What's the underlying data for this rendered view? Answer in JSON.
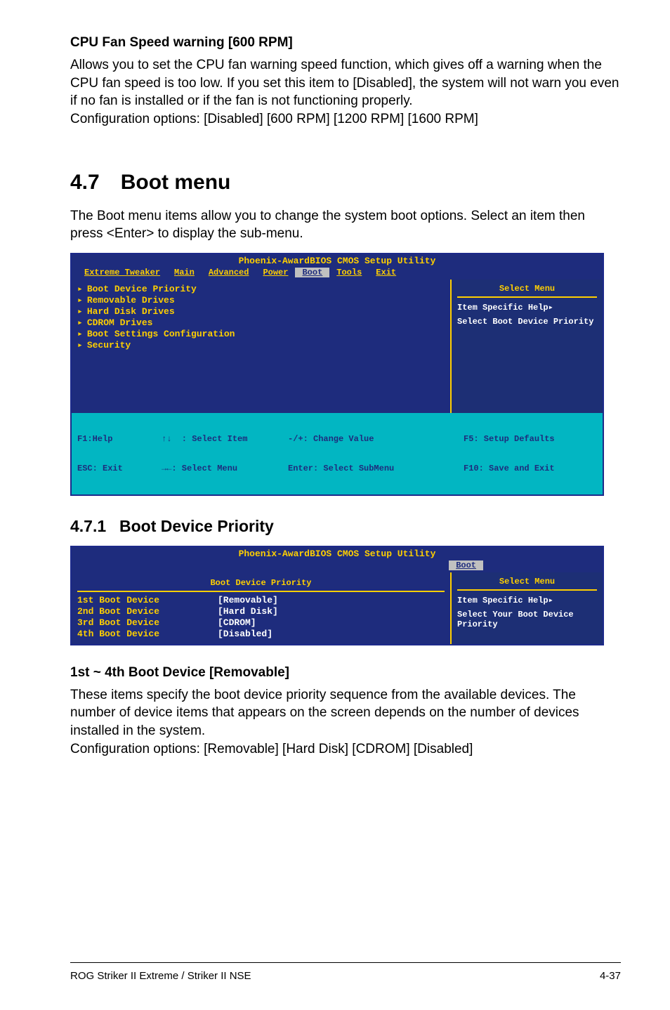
{
  "sec1": {
    "title": "CPU Fan Speed warning [600 RPM]",
    "body": "Allows you to set the CPU fan warning speed function, which gives off a warning when the CPU fan speed is too low. If you set this item to [Disabled], the system will not warn you even if no fan is installed or if the fan is not functioning properly.\nConfiguration options: [Disabled] [600 RPM] [1200 RPM] [1600 RPM]"
  },
  "heading47": {
    "num": "4.7",
    "text": "Boot menu"
  },
  "intro47": "The Boot menu items allow you to change the system boot options. Select an item then press <Enter> to display the sub-menu.",
  "bios1": {
    "title": "Phoenix-AwardBIOS CMOS Setup Utility",
    "tabs": [
      "Extreme Tweaker",
      "Main",
      "Advanced",
      "Power",
      "Boot",
      "Tools",
      "Exit"
    ],
    "active_tab": "Boot",
    "left_items": [
      "Boot Device Priority",
      "Removable Drives",
      "Hard Disk Drives",
      "CDROM Drives",
      "Boot Settings Configuration",
      "Security"
    ],
    "right_title": "Select Menu",
    "right_help1": "Item Specific Help",
    "right_help2": "Select Boot Device Priority",
    "footer": {
      "f1": "F1:Help",
      "esc": "ESC: Exit",
      "sel_item": "↑↓  : Select Item",
      "sel_menu": "→←: Select Menu",
      "change": "-/+: Change Value",
      "enter": "Enter: Select SubMenu",
      "f5": "F5: Setup Defaults",
      "f10": "F10: Save and Exit"
    }
  },
  "heading471": {
    "num": "4.7.1",
    "text": "Boot Device Priority"
  },
  "bios2": {
    "title": "Phoenix-AwardBIOS CMOS Setup Utility",
    "active_tab": "Boot",
    "screen_title": "Boot Device Priority",
    "rows": [
      {
        "label": "1st Boot Device",
        "value": "[Removable]"
      },
      {
        "label": "2nd Boot Device",
        "value": "[Hard Disk]"
      },
      {
        "label": "3rd Boot Device",
        "value": "[CDROM]"
      },
      {
        "label": "4th Boot Device",
        "value": "[Disabled]"
      }
    ],
    "right_title": "Select Menu",
    "right_help1": "Item Specific Help",
    "right_help2": "Select Your Boot Device Priority"
  },
  "sec2": {
    "title": "1st ~ 4th Boot Device [Removable]",
    "body": "These items specify the boot device priority sequence from the available devices. The number of device items that appears on the screen depends on the number of devices installed in the system.\nConfiguration options: [Removable] [Hard Disk] [CDROM] [Disabled]"
  },
  "footer": {
    "left": "ROG Striker II Extreme / Striker II NSE",
    "right": "4-37"
  }
}
